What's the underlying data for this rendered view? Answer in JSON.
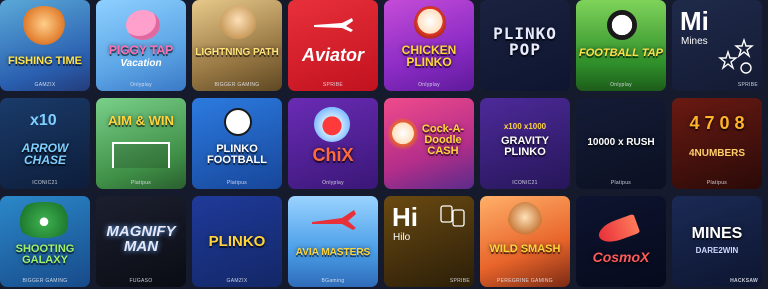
{
  "games": [
    {
      "title": "FISHING TIME",
      "provider": "GAMZIX",
      "bg": "linear-gradient(160deg,#5aa9d8,#2a5fb0 70%,#243c7a)",
      "color": "#ffe14a"
    },
    {
      "title": "PIGGY TAP",
      "subtitle": "Vacation",
      "provider": "Onlyplay",
      "bg": "linear-gradient(160deg,#8ed0ff,#5da6e6 60%,#3a78c6)",
      "color": "#ff6fb1"
    },
    {
      "title": "LIGHTNING PATH",
      "provider": "BIGGER GAMING",
      "bg": "linear-gradient(160deg,#e8c98a,#9a7a45 60%,#5e4722)",
      "color": "#ffe27a"
    },
    {
      "title": "Aviator",
      "provider": "SPRIBE",
      "bg": "linear-gradient(160deg,#e8303a,#c1121f)",
      "color": "#ffffff"
    },
    {
      "title": "CHICKEN PLINKO",
      "provider": "Onlyplay",
      "bg": "linear-gradient(160deg,#c54cd8,#8a2bc4 60%,#5e1a9a)",
      "color": "#ffd43b"
    },
    {
      "title": "PLINKO POP",
      "provider": "",
      "bg": "linear-gradient(160deg,#1a2240,#0e1530)",
      "color": "#e9ecff"
    },
    {
      "title": "FOOTBALL TAP",
      "provider": "Onlyplay",
      "bg": "linear-gradient(180deg,#7fd35a,#2f8f2a 70%,#1d5c1a)",
      "color": "#ffe14a"
    },
    {
      "big": "Mi",
      "small": "Mines",
      "provider": "SPRIBE",
      "bg": "linear-gradient(160deg,#1f2a4a,#131a33)",
      "color": "#ffffff"
    },
    {
      "title": "ARROW CHASE",
      "extra": "x10",
      "provider": "ICONIC21",
      "bg": "linear-gradient(160deg,#1a3b6a,#0d1d3a)",
      "color": "#7fd0ff"
    },
    {
      "title": "AIM & WIN",
      "provider": "Platipus",
      "bg": "linear-gradient(160deg,#7ad08a,#3f8f46 70%,#2a5f2f)",
      "color": "#ffd43b"
    },
    {
      "title": "PLINKO FOOTBALL",
      "provider": "Platipus",
      "bg": "linear-gradient(160deg,#2c7be0,#17469a)",
      "color": "#ffffff"
    },
    {
      "title": "ChiX",
      "provider": "Onlyplay",
      "bg": "linear-gradient(160deg,#6a2bb5,#3a1777)",
      "color": "#ff6a3d"
    },
    {
      "title": "Cock-A-Doodle CASH",
      "provider": "",
      "bg": "linear-gradient(160deg,#f04b8b,#b42e8a 60%,#5a2b8a)",
      "color": "#ffd43b"
    },
    {
      "title": "GRAVITY PLINKO",
      "extra": "x100  x1000",
      "provider": "ICONIC21",
      "bg": "linear-gradient(160deg,#4d2a9a,#261659)",
      "color": "#ffffff"
    },
    {
      "title": "10000 x RUSH",
      "provider": "Platipus",
      "bg": "linear-gradient(160deg,#141c36,#0b1022)",
      "color": "#ffffff"
    },
    {
      "title": "4 7 0 8",
      "subtitle": "4NUMBERS",
      "provider": "Platipus",
      "bg": "linear-gradient(160deg,#6a1a12,#2a0a08)",
      "color": "#ffb22a"
    },
    {
      "title": "SHOOTING GALAXY",
      "provider": "BIGGER GAMING",
      "bg": "linear-gradient(160deg,#2b88c9,#174a8a)",
      "color": "#9ef26a"
    },
    {
      "title": "MAGNIFY MAN",
      "provider": "FUGASO",
      "bg": "linear-gradient(160deg,#1c1f2e,#0a0c14)",
      "color": "#e6e9f5"
    },
    {
      "title": "PLINKO",
      "provider": "GAMZIX",
      "bg": "linear-gradient(160deg,#1f3a9a,#132766)",
      "color": "#ffd43b"
    },
    {
      "title": "AVIA MASTERS",
      "provider": "BGaming",
      "bg": "linear-gradient(180deg,#9ad3ff,#4a9ee8 60%,#2f6bb8)",
      "color": "#ffd43b"
    },
    {
      "big": "Hi",
      "small": "Hilo",
      "provider": "SPRIBE",
      "bg": "linear-gradient(160deg,#6a4a12,#2b1e08)",
      "color": "#ffffff"
    },
    {
      "title": "WILD SMASH",
      "provider": "PEREGRINE GAMING",
      "bg": "linear-gradient(160deg,#ffb06a,#e8642a 60%,#7a2a14)",
      "color": "#ffd43b"
    },
    {
      "title": "CosmoX",
      "provider": "",
      "bg": "linear-gradient(160deg,#0e1430,#060a1c)",
      "color": "#ff5a5a"
    },
    {
      "title": "MINES",
      "subtitle": "DARE2WIN",
      "provider": "HACKSAW",
      "bg": "linear-gradient(160deg,#1b2a55,#0d1530)",
      "color": "#ffffff"
    }
  ]
}
